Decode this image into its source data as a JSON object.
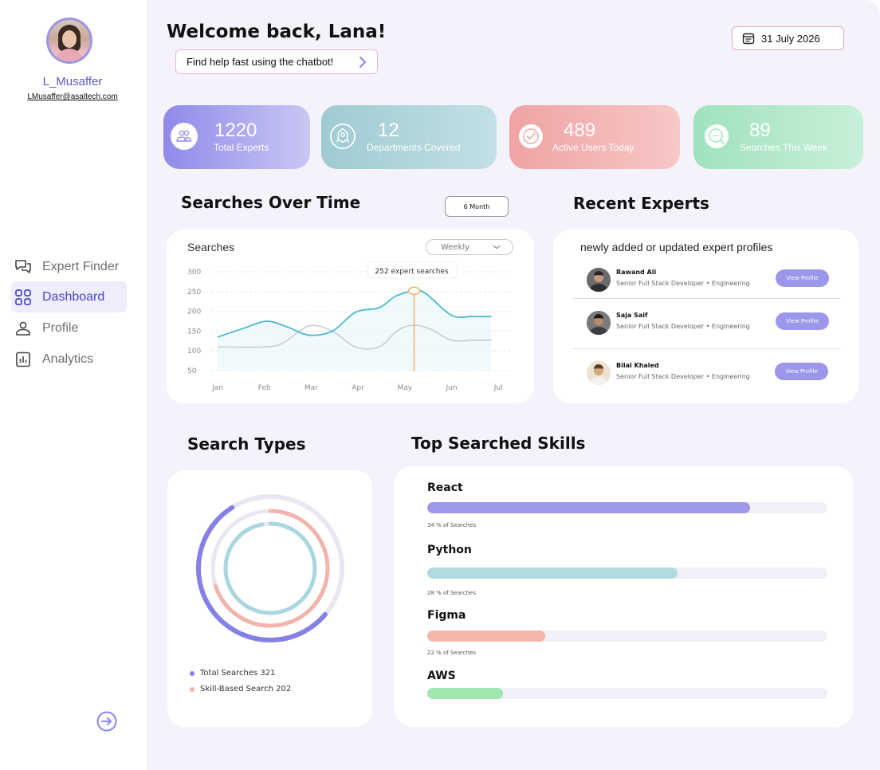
{
  "user": {
    "name": "L_Musaffer",
    "email": "LMusaffer@asaltech.com"
  },
  "nav": [
    {
      "label": "Expert Finder",
      "icon": "chat-icon",
      "active": false
    },
    {
      "label": "Dashboard",
      "icon": "grid-icon",
      "active": true
    },
    {
      "label": "Profile",
      "icon": "person-icon",
      "active": false
    },
    {
      "label": "Analytics",
      "icon": "bar-chart-icon",
      "active": false
    }
  ],
  "header": {
    "welcome": "Welcome back, Lana!",
    "chatbot": "Find help fast using the chatbot!",
    "date": "31 July 2026"
  },
  "stats": [
    {
      "value": "1220",
      "label": "Total Experts",
      "icon": "people-icon",
      "color": "#9d98ea"
    },
    {
      "value": "12",
      "label": "Departments Covered",
      "icon": "building-icon",
      "color": "#9fcfd6"
    },
    {
      "value": "489",
      "label": "Active Users Today",
      "icon": "check-circle-icon",
      "color": "#f2aeac"
    },
    {
      "value": "89",
      "label": "Searches This Week",
      "icon": "search-chat-icon",
      "color": "#a6e5c0"
    }
  ],
  "searches_over_time": {
    "section_title": "Searches Over Time",
    "range_button": "6 Month",
    "weekly": "Weekly",
    "tooltip": "252 expert searches"
  },
  "chart_data": {
    "type": "line",
    "title": "Searches",
    "categories": [
      "Jan",
      "Feb",
      "Mar",
      "Apr",
      "May",
      "Jun",
      "Jul"
    ],
    "x": [
      0,
      1,
      2,
      3,
      4,
      5,
      6
    ],
    "y_ticks": [
      300,
      250,
      200,
      150,
      100,
      50
    ],
    "ylim": [
      50,
      300
    ],
    "grid": true,
    "legend": "none",
    "series": [
      {
        "x": [
          0,
          0.55,
          1.05,
          1.5,
          1.95,
          2.45,
          2.95,
          3.45,
          3.8,
          4.2,
          4.45,
          5.0,
          5.45,
          5.85
        ],
        "values": [
          135,
          157,
          175,
          160,
          140,
          150,
          198,
          209,
          238,
          252,
          245,
          190,
          187,
          187
        ],
        "color": "#4ab8cf"
      },
      {
        "x": [
          0,
          1.0,
          1.4,
          1.95,
          2.45,
          2.95,
          3.45,
          3.85,
          4.2,
          4.55,
          5.0,
          5.45,
          5.85
        ],
        "values": [
          110,
          110,
          120,
          163,
          150,
          110,
          110,
          152,
          165,
          155,
          127,
          127,
          127
        ],
        "color": "#c9cdd4"
      }
    ],
    "highlight": {
      "category": "May",
      "value": 252
    }
  },
  "recent_experts": {
    "section_title": "Recent Experts",
    "subtitle": "newly added or updated expert profiles",
    "items": [
      {
        "name": "Rawand Ali",
        "role": "Senior Full Stack Developer • Engineering",
        "button": "View Profile"
      },
      {
        "name": "Saja Saif",
        "role": "Senior Full Stack Developer • Engineering",
        "button": "View Profile"
      },
      {
        "name": "Bilal Khaled",
        "role": "Senior Full Stack Developer • Engineering",
        "button": "View Profile"
      }
    ]
  },
  "search_types": {
    "section_title": "Search Types",
    "legend": [
      {
        "label": "Total Searches 321",
        "color": "#8580e6"
      },
      {
        "label": "Skill-Based Search 202",
        "color": "#f2b3ab"
      }
    ],
    "rings": [
      {
        "fraction": 0.55,
        "color": "#8580e6"
      },
      {
        "fraction": 0.7,
        "color": "#f2b3ab"
      },
      {
        "fraction": 0.97,
        "color": "#a9d6df"
      }
    ]
  },
  "top_skills": {
    "section_title": "Top Searched Skills",
    "items": [
      {
        "name": "React",
        "pct_label": "34 % of Searches",
        "fill": 0.807,
        "color": "#9d98ea"
      },
      {
        "name": "Python",
        "pct_label": "28 % of Searches",
        "fill": 0.625,
        "color": "#b0dce0"
      },
      {
        "name": "Figma",
        "pct_label": "22 % of Searches",
        "fill": 0.295,
        "color": "#f3b6ab"
      },
      {
        "name": "AWS",
        "pct_label": "",
        "fill": 0.19,
        "color": "#a1e6b0"
      }
    ]
  }
}
